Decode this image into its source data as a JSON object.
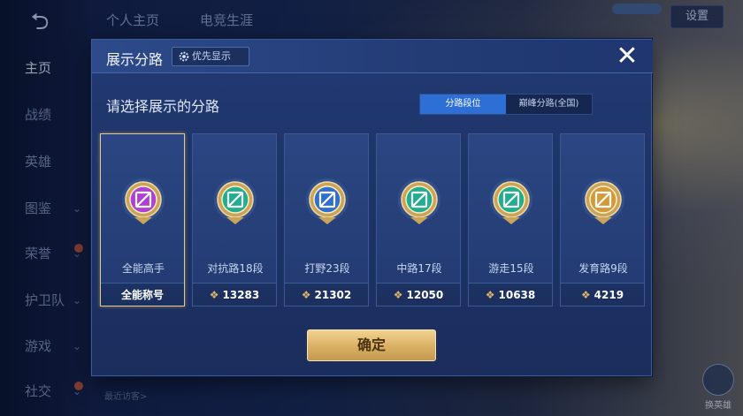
{
  "background": {
    "back_icon": "back-arrow-icon",
    "top_tabs": [
      "个人主页",
      "电竞生涯"
    ],
    "settings_label": "设置",
    "nav": [
      {
        "label": "主页",
        "active": true,
        "chevron": false,
        "dot": false
      },
      {
        "label": "战绩",
        "active": false,
        "chevron": false,
        "dot": false
      },
      {
        "label": "英雄",
        "active": false,
        "chevron": false,
        "dot": false
      },
      {
        "label": "图鉴",
        "active": false,
        "chevron": true,
        "dot": false
      },
      {
        "label": "荣誉",
        "active": false,
        "chevron": true,
        "dot": true
      },
      {
        "label": "护卫队",
        "active": false,
        "chevron": true,
        "dot": false
      },
      {
        "label": "游戏",
        "active": false,
        "chevron": true,
        "dot": false
      },
      {
        "label": "社交",
        "active": false,
        "chevron": true,
        "dot": true
      }
    ],
    "recent_visitors_label": "最近访客>",
    "right_btn_bottom_label": "换英雄"
  },
  "modal": {
    "title": "展示分路",
    "priority_label": "优先显示",
    "close_icon": "close-icon",
    "subtitle": "请选择展示的分路",
    "toggle": [
      {
        "label": "分路段位",
        "active": true
      },
      {
        "label": "巅峰分路(全国)",
        "active": false
      }
    ],
    "cards": [
      {
        "label": "全能高手",
        "footer": "全能称号",
        "points": null,
        "selected": true,
        "badge_color": "#b03fd6",
        "badge_icon": "all-round-badge-icon"
      },
      {
        "label": "对抗路18段",
        "footer": "13283",
        "points": true,
        "selected": false,
        "badge_color": "#1fae8f",
        "badge_icon": "clash-lane-badge-icon"
      },
      {
        "label": "打野23段",
        "footer": "21302",
        "points": true,
        "selected": false,
        "badge_color": "#2f6fd0",
        "badge_icon": "jungle-badge-icon"
      },
      {
        "label": "中路17段",
        "footer": "12050",
        "points": true,
        "selected": false,
        "badge_color": "#1fae8f",
        "badge_icon": "mid-lane-badge-icon"
      },
      {
        "label": "游走15段",
        "footer": "10638",
        "points": true,
        "selected": false,
        "badge_color": "#1fae8f",
        "badge_icon": "roam-badge-icon"
      },
      {
        "label": "发育路9段",
        "footer": "4219",
        "points": true,
        "selected": false,
        "badge_color": "#d49a3a",
        "badge_icon": "farm-lane-badge-icon"
      }
    ],
    "confirm_label": "确定"
  }
}
